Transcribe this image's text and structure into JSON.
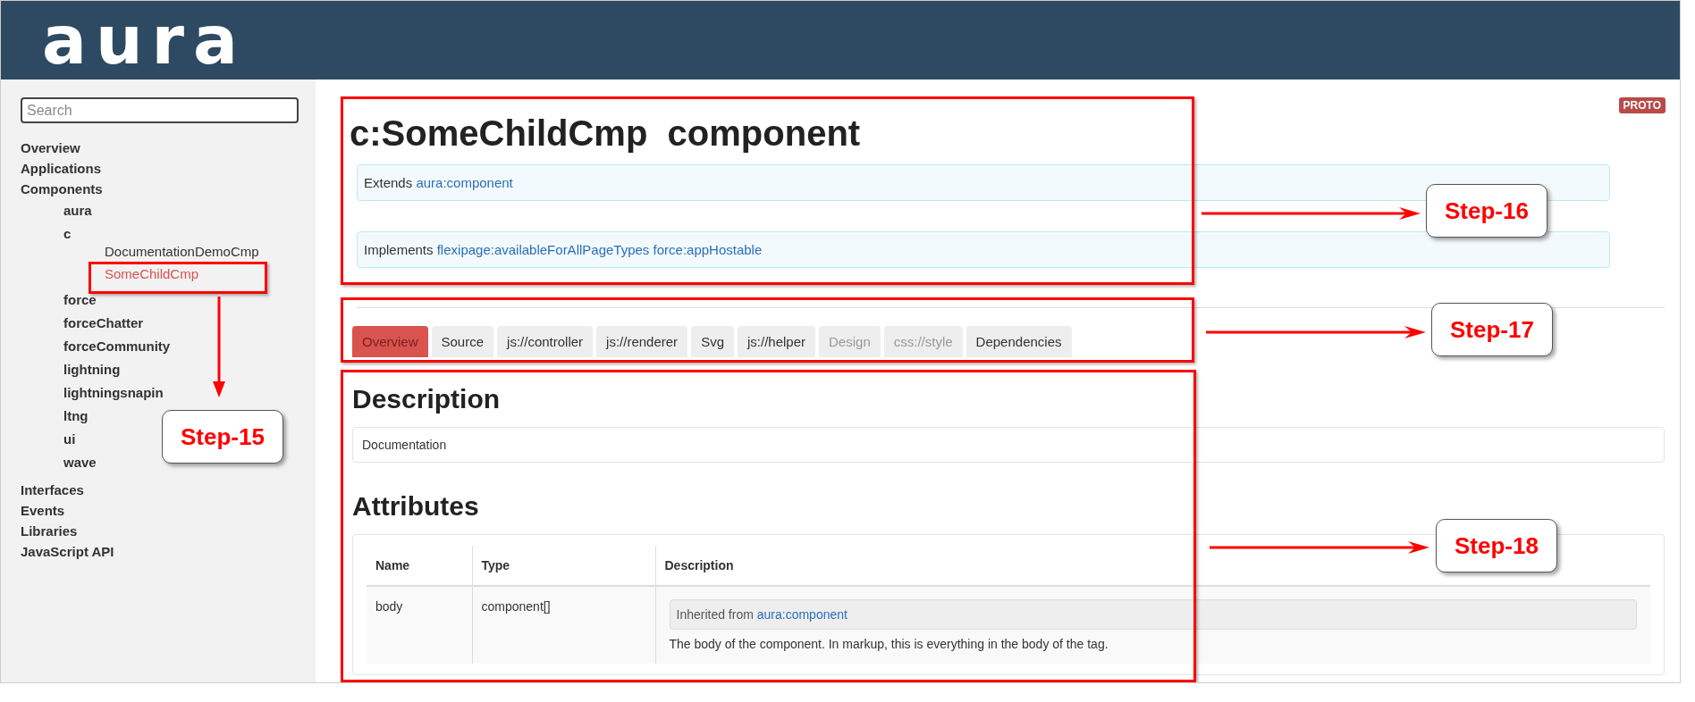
{
  "header": {
    "logo": "aura"
  },
  "sidebar": {
    "search": {
      "placeholder": "Search"
    },
    "items": [
      {
        "label": "Overview",
        "selected": false
      },
      {
        "label": "Applications",
        "selected": false
      },
      {
        "label": "Components",
        "selected": false,
        "children": [
          {
            "label": "aura",
            "selected": false
          },
          {
            "label": "c",
            "selected": false,
            "children": [
              {
                "label": "DocumentationDemoCmp",
                "selected": false
              },
              {
                "label": "SomeChildCmp",
                "selected": true
              }
            ]
          },
          {
            "label": "force",
            "selected": false
          },
          {
            "label": "forceChatter",
            "selected": false
          },
          {
            "label": "forceCommunity",
            "selected": false
          },
          {
            "label": "lightning",
            "selected": false
          },
          {
            "label": "lightningsnapin",
            "selected": false
          },
          {
            "label": "ltng",
            "selected": false
          },
          {
            "label": "ui",
            "selected": false
          },
          {
            "label": "wave",
            "selected": false
          }
        ]
      },
      {
        "label": "Interfaces",
        "selected": false
      },
      {
        "label": "Events",
        "selected": false
      },
      {
        "label": "Libraries",
        "selected": false
      },
      {
        "label": "JavaScript API",
        "selected": false
      }
    ]
  },
  "badge": "PROTO",
  "title": "c:SomeChildCmp  component",
  "extends": {
    "label": "Extends",
    "links": [
      "aura:component"
    ]
  },
  "implements": {
    "label": "Implements",
    "links": [
      "flexipage:availableForAllPageTypes",
      "force:appHostable"
    ]
  },
  "tabs": [
    {
      "label": "Overview",
      "selected": true,
      "disabled": false
    },
    {
      "label": "Source",
      "selected": false,
      "disabled": false
    },
    {
      "label": "js://controller",
      "selected": false,
      "disabled": false
    },
    {
      "label": "js://renderer",
      "selected": false,
      "disabled": false
    },
    {
      "label": "Svg",
      "selected": false,
      "disabled": false
    },
    {
      "label": "js://helper",
      "selected": false,
      "disabled": false
    },
    {
      "label": "Design",
      "selected": false,
      "disabled": true
    },
    {
      "label": "css://style",
      "selected": false,
      "disabled": true
    },
    {
      "label": "Dependencies",
      "selected": false,
      "disabled": false
    }
  ],
  "description": {
    "heading": "Description",
    "text": "Documentation"
  },
  "attributes": {
    "heading": "Attributes",
    "columns": [
      "Name",
      "Type",
      "Description"
    ],
    "rows": [
      {
        "name": "body",
        "type": "component[]",
        "inherited_label": "Inherited from",
        "inherited_link": "aura:component",
        "description": "The body of the component. In markup, this is everything in the body of the tag."
      }
    ]
  },
  "annotations": [
    {
      "label": "Step-15"
    },
    {
      "label": "Step-16"
    },
    {
      "label": "Step-17"
    },
    {
      "label": "Step-18"
    }
  ]
}
